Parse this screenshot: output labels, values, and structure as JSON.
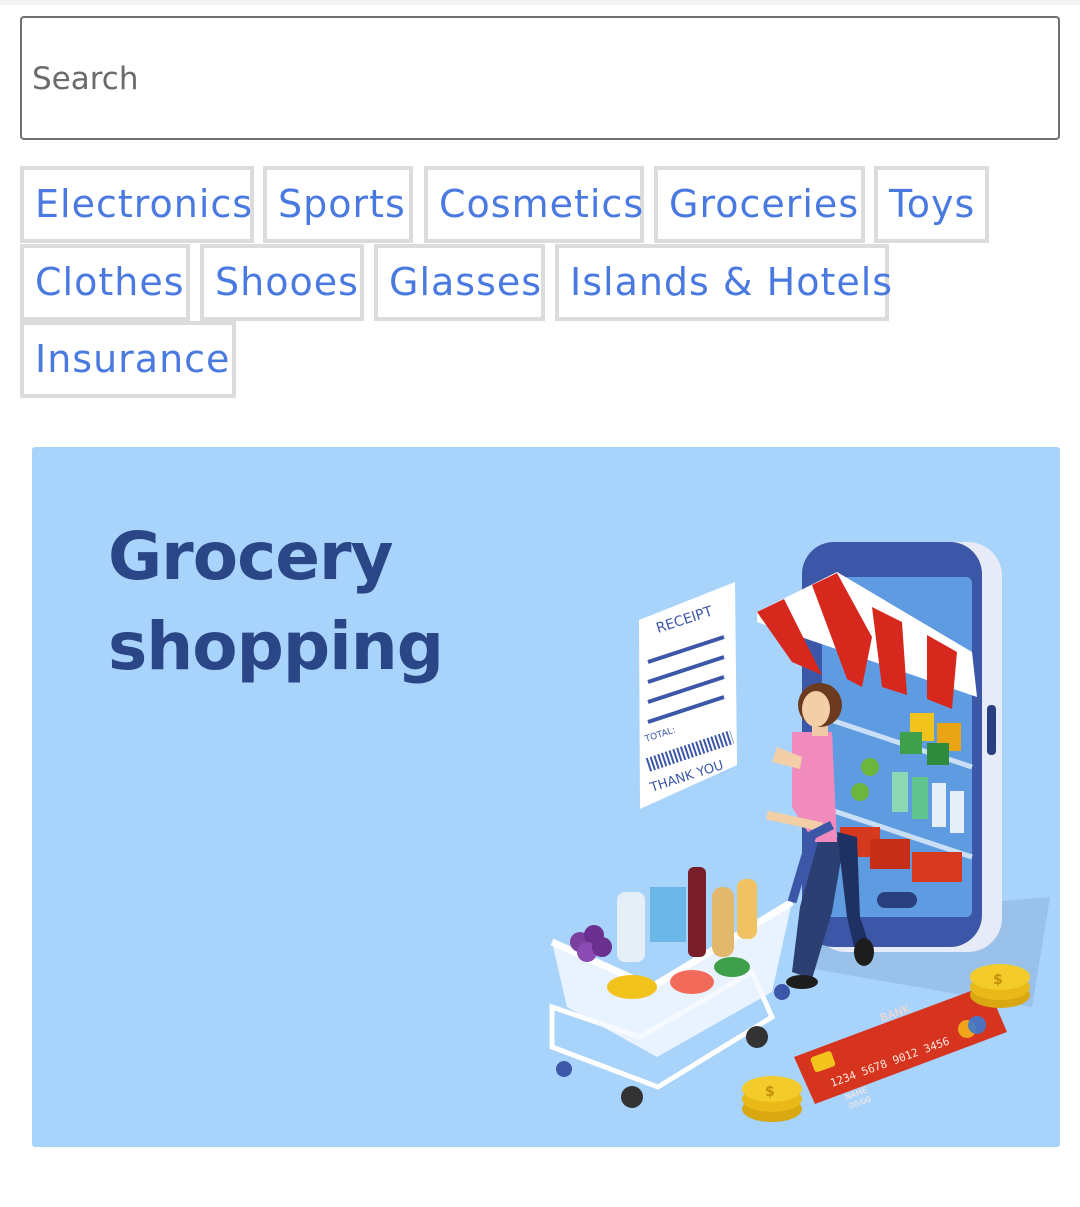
{
  "search": {
    "placeholder": "Search"
  },
  "categories": [
    "Electronics",
    "Sports",
    "Cosmetics",
    "Groceries",
    "Toys",
    "Clothes",
    "Shooes",
    "Glasses",
    "Islands & Hotels",
    "Insurance"
  ],
  "banner": {
    "title_line1": "Grocery",
    "title_line2": "shopping",
    "receipt": {
      "header": "RECEIPT",
      "total": "TOTAL:",
      "footer": "THANK YOU"
    },
    "card": {
      "bank": "BANK",
      "number": "1234 5678 9012 3456",
      "name": "NAME",
      "expiry": "00/00"
    }
  },
  "colors": {
    "chip_text": "#4a7ae0",
    "chip_border": "#dcdcdc",
    "banner_bg": "#a8d3fb",
    "banner_title": "#2b4687"
  }
}
